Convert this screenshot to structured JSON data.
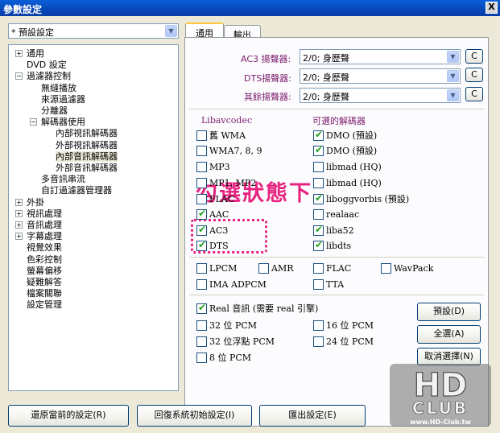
{
  "window": {
    "title": "參數設定",
    "close_glyph": "X"
  },
  "preset": {
    "value": "* 預設設定"
  },
  "tree": {
    "items": [
      {
        "label": "通用",
        "toggle": "+"
      },
      {
        "label": "DVD 設定",
        "toggle": ""
      },
      {
        "label": "過濾器控制",
        "toggle": "−"
      },
      {
        "label": "無縫播放",
        "toggle": ""
      },
      {
        "label": "來源過濾器",
        "toggle": ""
      },
      {
        "label": "分離器",
        "toggle": ""
      },
      {
        "label": "解碼器使用",
        "toggle": "−"
      },
      {
        "label": "內部視訊解碼器",
        "toggle": ""
      },
      {
        "label": "外部視訊解碼器",
        "toggle": ""
      },
      {
        "label": "內部音訊解碼器",
        "toggle": ""
      },
      {
        "label": "外部音訊解碼器",
        "toggle": ""
      },
      {
        "label": "多音訊串流",
        "toggle": ""
      },
      {
        "label": "自訂過濾器管理器",
        "toggle": ""
      },
      {
        "label": "外掛",
        "toggle": "+"
      },
      {
        "label": "視訊處理",
        "toggle": "+"
      },
      {
        "label": "音訊處理",
        "toggle": "+"
      },
      {
        "label": "字幕處理",
        "toggle": "+"
      },
      {
        "label": "視覺效果",
        "toggle": ""
      },
      {
        "label": "色彩控制",
        "toggle": ""
      },
      {
        "label": "螢幕偏移",
        "toggle": ""
      },
      {
        "label": "疑難解答",
        "toggle": ""
      },
      {
        "label": "檔案關聯",
        "toggle": ""
      },
      {
        "label": "設定管理",
        "toggle": ""
      }
    ]
  },
  "tabs": [
    {
      "label": "通用"
    },
    {
      "label": "輸出"
    }
  ],
  "speakers": {
    "ac3": {
      "label": "AC3 揚聲器:",
      "value": "2/0; 身歷聲",
      "button": "C"
    },
    "dts": {
      "label": "DTS揚聲器:",
      "value": "2/0; 身歷聲",
      "button": "C"
    },
    "other": {
      "label": "其餘揚聲器:",
      "value": "2/0; 身歷聲",
      "button": "C"
    }
  },
  "columns": {
    "left": "Libavcodec",
    "right": "可選的解碼器"
  },
  "libav": [
    {
      "label": "舊 WMA",
      "checked": false
    },
    {
      "label": "WMA7, 8, 9",
      "checked": false
    },
    {
      "label": "MP3",
      "checked": false
    },
    {
      "label": "MP1, MP2",
      "checked": false
    },
    {
      "label": "FLAC",
      "checked": false
    },
    {
      "label": "AAC",
      "checked": true
    },
    {
      "label": "AC3",
      "checked": true
    },
    {
      "label": "DTS",
      "checked": true
    }
  ],
  "optional": [
    {
      "label": "DMO (預設)",
      "checked": true
    },
    {
      "label": "DMO (預設)",
      "checked": true
    },
    {
      "label": "libmad (HQ)",
      "checked": false
    },
    {
      "label": "libmad (HQ)",
      "checked": false
    },
    {
      "label": "liboggvorbis (預設)",
      "checked": true
    },
    {
      "label": "realaac",
      "checked": false
    },
    {
      "label": "liba52",
      "checked": true
    },
    {
      "label": "libdts",
      "checked": true
    }
  ],
  "raw_formats": [
    {
      "label": "LPCM",
      "checked": false
    },
    {
      "label": "AMR",
      "checked": false
    },
    {
      "label": "FLAC",
      "checked": false
    },
    {
      "label": "WavPack",
      "checked": false
    },
    {
      "label": "IMA ADPCM",
      "checked": false
    },
    {
      "label": "TTA",
      "checked": false
    }
  ],
  "output": [
    {
      "label": "Real 音訊 (需要 real 引擎)",
      "checked": true
    },
    {
      "label": "32 位 PCM",
      "checked": false
    },
    {
      "label": "16 位 PCM",
      "checked": false
    },
    {
      "label": "32 位浮點 PCM",
      "checked": false
    },
    {
      "label": "24 位 PCM",
      "checked": false
    },
    {
      "label": "8 位 PCM",
      "checked": false
    }
  ],
  "side_buttons": {
    "default": "預設(D)",
    "select_all": "全選(A)",
    "deselect": "取消選擇(N)"
  },
  "bottom_buttons": {
    "restore": "還原當前的設定(R)",
    "reset": "回復系統初始設定(I)",
    "export": "匯出設定(E)"
  },
  "annotation": {
    "text": "勾選狀態下"
  },
  "logo": {
    "line1": "HD",
    "line2": "CLUB",
    "url": "www.HD-Club.tw"
  },
  "colors": {
    "annotation": "#e6237f",
    "check": "#21a121",
    "titlebar": "#0846b8"
  }
}
